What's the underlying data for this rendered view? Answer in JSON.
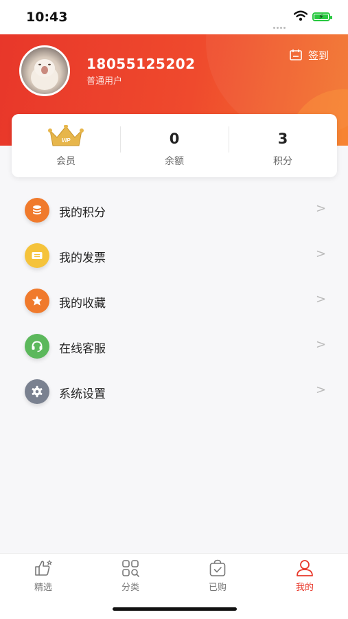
{
  "status_bar": {
    "time": "10:43"
  },
  "profile": {
    "phone": "18055125202",
    "user_type": "普通用户",
    "checkin_label": "签到"
  },
  "stats": {
    "member": {
      "badge": "VIP",
      "label": "会员"
    },
    "balance": {
      "value": "0",
      "label": "余额"
    },
    "points": {
      "value": "3",
      "label": "积分"
    }
  },
  "menu": {
    "items": [
      {
        "label": "我的积分",
        "icon": "coins-icon",
        "color": "#f07a2c"
      },
      {
        "label": "我的发票",
        "icon": "invoice-icon",
        "color": "#f5c33b"
      },
      {
        "label": "我的收藏",
        "icon": "star-icon",
        "color": "#f07a2c"
      },
      {
        "label": "在线客服",
        "icon": "headset-icon",
        "color": "#5cb85c"
      },
      {
        "label": "系统设置",
        "icon": "gear-icon",
        "color": "#7a8190"
      }
    ],
    "chevron": ">"
  },
  "tabbar": {
    "tabs": [
      {
        "label": "精选",
        "icon": "thumbs-up-icon"
      },
      {
        "label": "分类",
        "icon": "category-icon"
      },
      {
        "label": "已购",
        "icon": "purchased-bag-icon"
      },
      {
        "label": "我的",
        "icon": "profile-icon",
        "active": true
      }
    ]
  },
  "colors": {
    "accent": "#e8372a",
    "header_end": "#f3772f"
  }
}
